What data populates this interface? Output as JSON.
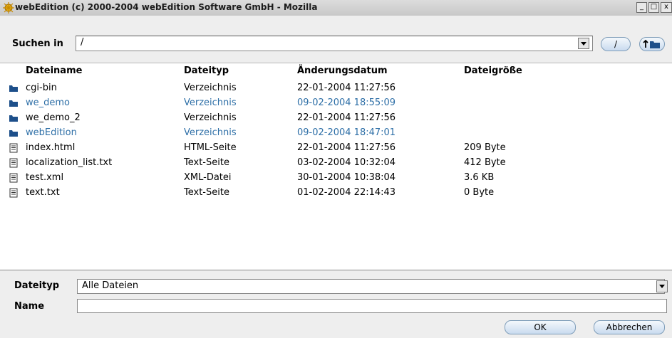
{
  "window": {
    "title": "webEdition (c) 2000-2004 webEdition Software GmbH - Mozilla",
    "minimize": "_",
    "maximize": "□",
    "close": "x"
  },
  "toolbar": {
    "search_label": "Suchen in",
    "path_value": "/",
    "root_button": "/",
    "up_button": "t■"
  },
  "columns": [
    "Dateiname",
    "Dateityp",
    "Änderungsdatum",
    "Dateigröße"
  ],
  "files": [
    {
      "name": "cgi-bin",
      "type": "Verzeichnis",
      "date": "22-01-2004 11:27:56",
      "size": "",
      "kind": "folder",
      "highlight": false
    },
    {
      "name": "we_demo",
      "type": "Verzeichnis",
      "date": "09-02-2004 18:55:09",
      "size": "",
      "kind": "folder",
      "highlight": true
    },
    {
      "name": "we_demo_2",
      "type": "Verzeichnis",
      "date": "22-01-2004 11:27:56",
      "size": "",
      "kind": "folder",
      "highlight": false
    },
    {
      "name": "webEdition",
      "type": "Verzeichnis",
      "date": "09-02-2004 18:47:01",
      "size": "",
      "kind": "folder",
      "highlight": true
    },
    {
      "name": "index.html",
      "type": "HTML-Seite",
      "date": "22-01-2004 11:27:56",
      "size": "209 Byte",
      "kind": "file",
      "highlight": false
    },
    {
      "name": "localization_list.txt",
      "type": "Text-Seite",
      "date": "03-02-2004 10:32:04",
      "size": "412 Byte",
      "kind": "file",
      "highlight": false
    },
    {
      "name": "test.xml",
      "type": "XML-Datei",
      "date": "30-01-2004 10:38:04",
      "size": "3.6 KB",
      "kind": "file",
      "highlight": false
    },
    {
      "name": "text.txt",
      "type": "Text-Seite",
      "date": "01-02-2004 22:14:43",
      "size": "0 Byte",
      "kind": "file",
      "highlight": false
    }
  ],
  "bottom": {
    "type_label": "Dateityp",
    "type_value": "Alle Dateien",
    "name_label": "Name",
    "name_value": "",
    "ok_label": "OK",
    "cancel_label": "Abbrechen"
  },
  "colors": {
    "folder_icon": "#1d4f8a",
    "highlight_text": "#2e6fa7",
    "button_border": "#7f9db9"
  },
  "icons": {
    "folder": "folder-icon",
    "file": "document-icon"
  }
}
